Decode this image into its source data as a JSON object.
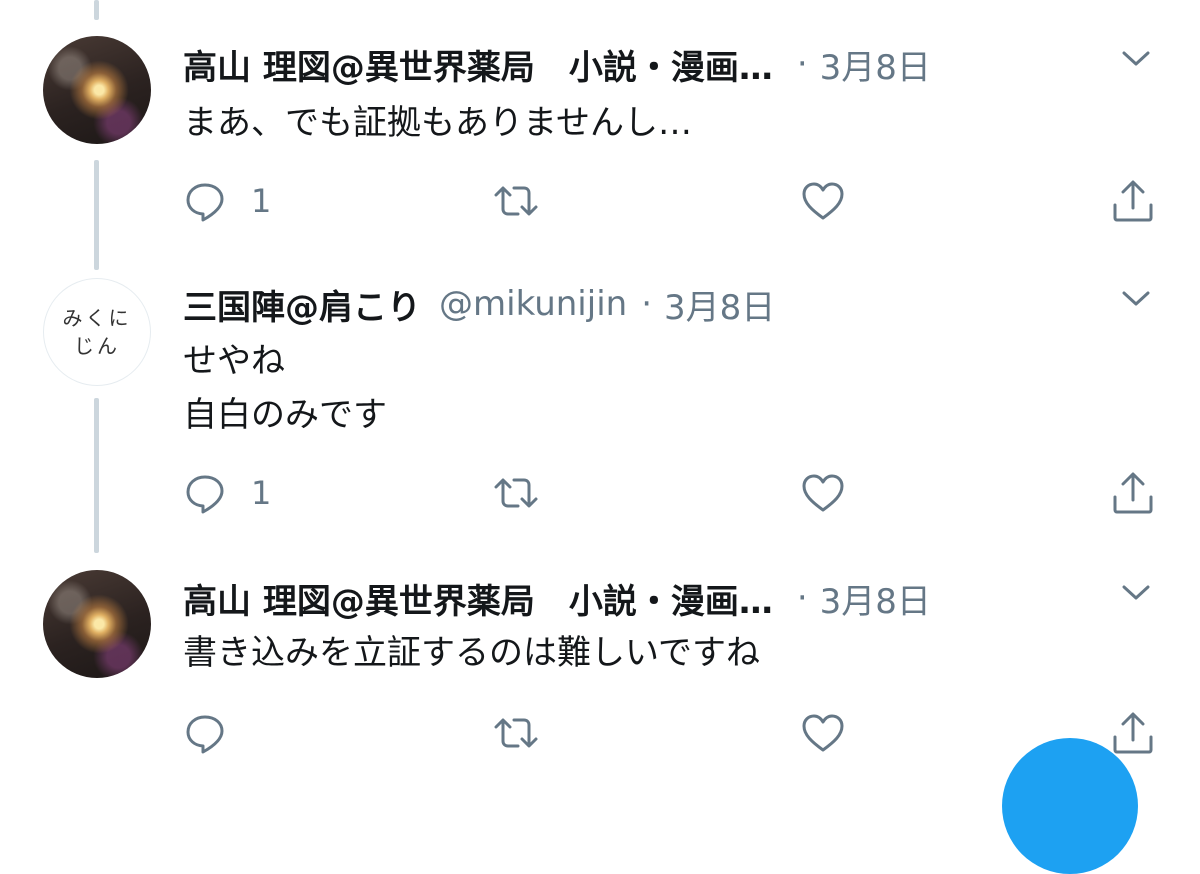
{
  "tweets": [
    {
      "name": "高山 理図@異世界薬局　小説・漫画…",
      "handle": "",
      "time": "3月8日",
      "avatar": "photo",
      "lines": [
        "まあ、でも証拠もありませんし…"
      ],
      "reply_count": "1"
    },
    {
      "name": "三国陣@肩こり",
      "handle": "@mikunijin",
      "time": "3月8日",
      "avatar_text": [
        "みくに",
        "じん"
      ],
      "lines": [
        "せやね",
        "自白のみです"
      ],
      "reply_count": "1"
    },
    {
      "name": "高山 理図@異世界薬局　小説・漫画…",
      "handle": "",
      "time": "3月8日",
      "avatar": "photo",
      "lines": [
        "書き込みを立証するのは難しいですね"
      ],
      "reply_count": ""
    }
  ],
  "separator": "·",
  "icons": {
    "reply": "reply-icon",
    "retweet": "retweet-icon",
    "like": "heart-icon",
    "share": "share-icon",
    "menu": "chevron-down-icon"
  },
  "colors": {
    "text": "#14171a",
    "muted": "#657786",
    "thread_line": "#ccd6dd",
    "accent": "#1da1f2"
  }
}
